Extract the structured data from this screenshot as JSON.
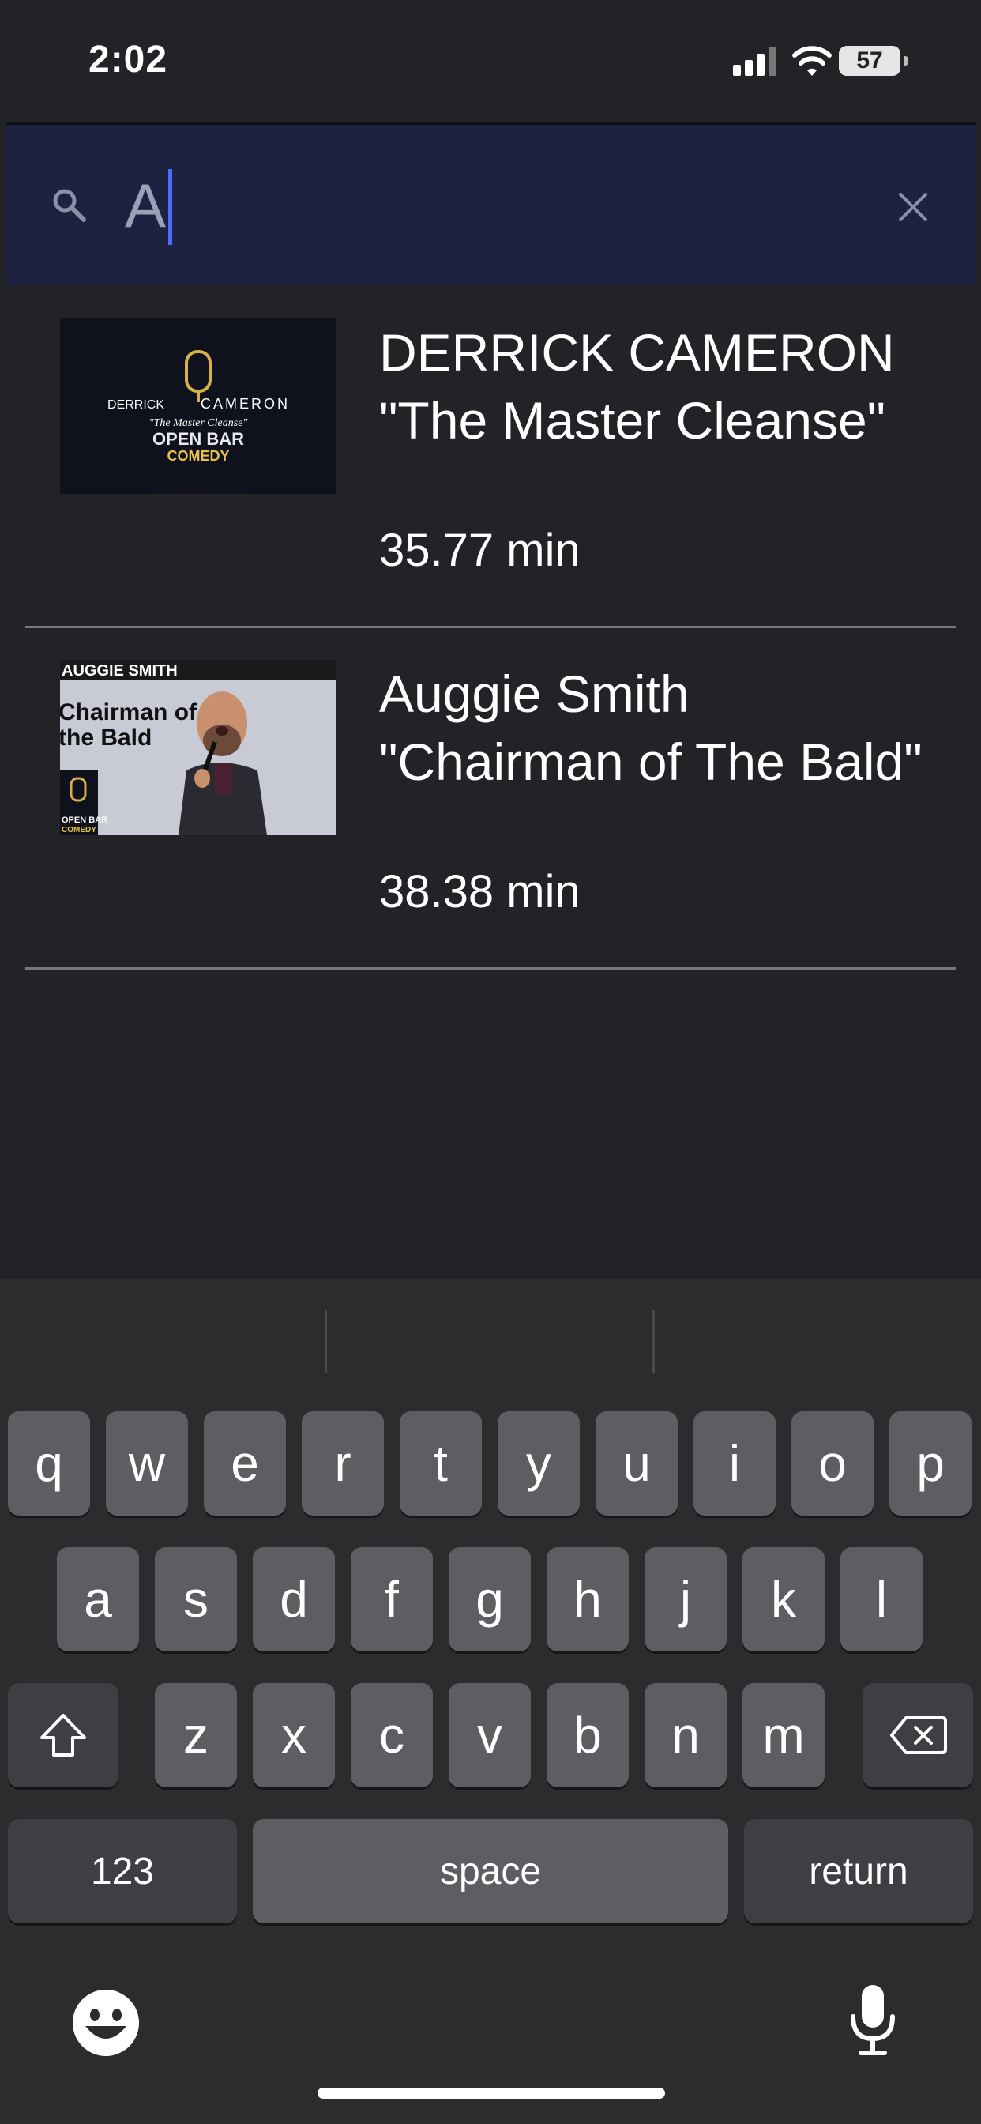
{
  "status_bar": {
    "time": "2:02",
    "battery": "57"
  },
  "search": {
    "value": "A",
    "placeholder": ""
  },
  "results": [
    {
      "title": "DERRICK CAMERON \"The Master Cleanse\"",
      "duration": "35.77 min",
      "thumb": {
        "line1_left": "DERRICK",
        "line1_right": "CAMERON",
        "subtitle": "\"The Master Cleanse\"",
        "brand_top": "OPEN BAR",
        "brand_bottom": "COMEDY"
      }
    },
    {
      "title": "Auggie Smith \"Chairman of The Bald\"",
      "duration": "38.38 min",
      "thumb": {
        "name": "AUGGIE SMITH",
        "line2": "Chairman of",
        "line3": "the Bald",
        "brand_top": "OPEN BAR",
        "brand_bottom": "COMEDY"
      }
    }
  ],
  "keyboard": {
    "row1": [
      "q",
      "w",
      "e",
      "r",
      "t",
      "y",
      "u",
      "i",
      "o",
      "p"
    ],
    "row2": [
      "a",
      "s",
      "d",
      "f",
      "g",
      "h",
      "j",
      "k",
      "l"
    ],
    "row3": [
      "z",
      "x",
      "c",
      "v",
      "b",
      "n",
      "m"
    ],
    "numbers_label": "123",
    "space_label": "space",
    "return_label": "return"
  },
  "colors": {
    "accent": "#4a6cff",
    "search_bg": "#1c2240",
    "bg": "#222327"
  }
}
